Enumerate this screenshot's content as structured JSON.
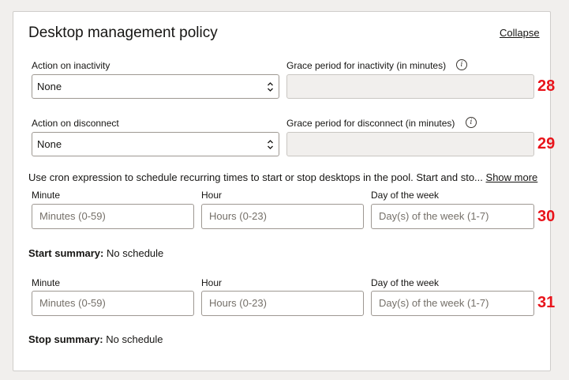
{
  "panel": {
    "title": "Desktop management policy",
    "collapse_label": "Collapse"
  },
  "inactivity": {
    "action_label": "Action on inactivity",
    "action_value": "None",
    "grace_label": "Grace period for inactivity (in minutes)"
  },
  "disconnect": {
    "action_label": "Action on disconnect",
    "action_value": "None",
    "grace_label": "Grace period for disconnect (in minutes)"
  },
  "cron": {
    "description": "Use cron expression to schedule recurring times to start or stop desktops in the pool. Start and sto...",
    "show_more": "Show more"
  },
  "start": {
    "minute_label": "Minute",
    "minute_placeholder": "Minutes (0-59)",
    "hour_label": "Hour",
    "hour_placeholder": "Hours (0-23)",
    "day_label": "Day of the week",
    "day_placeholder": "Day(s) of the week (1-7)",
    "summary_label": "Start summary:",
    "summary_value": "No schedule"
  },
  "stop": {
    "minute_label": "Minute",
    "minute_placeholder": "Minutes (0-59)",
    "hour_label": "Hour",
    "hour_placeholder": "Hours (0-23)",
    "day_label": "Day of the week",
    "day_placeholder": "Day(s) of the week (1-7)",
    "summary_label": "Stop summary:",
    "summary_value": "No schedule"
  },
  "markers": [
    "28",
    "29",
    "30",
    "31"
  ],
  "icons": {
    "info": "info-icon",
    "chevron": "chevron-up-down-icon"
  },
  "colors": {
    "marker": "#e8141b",
    "disabled_field": "#f1efed",
    "border": "#9e9892"
  }
}
